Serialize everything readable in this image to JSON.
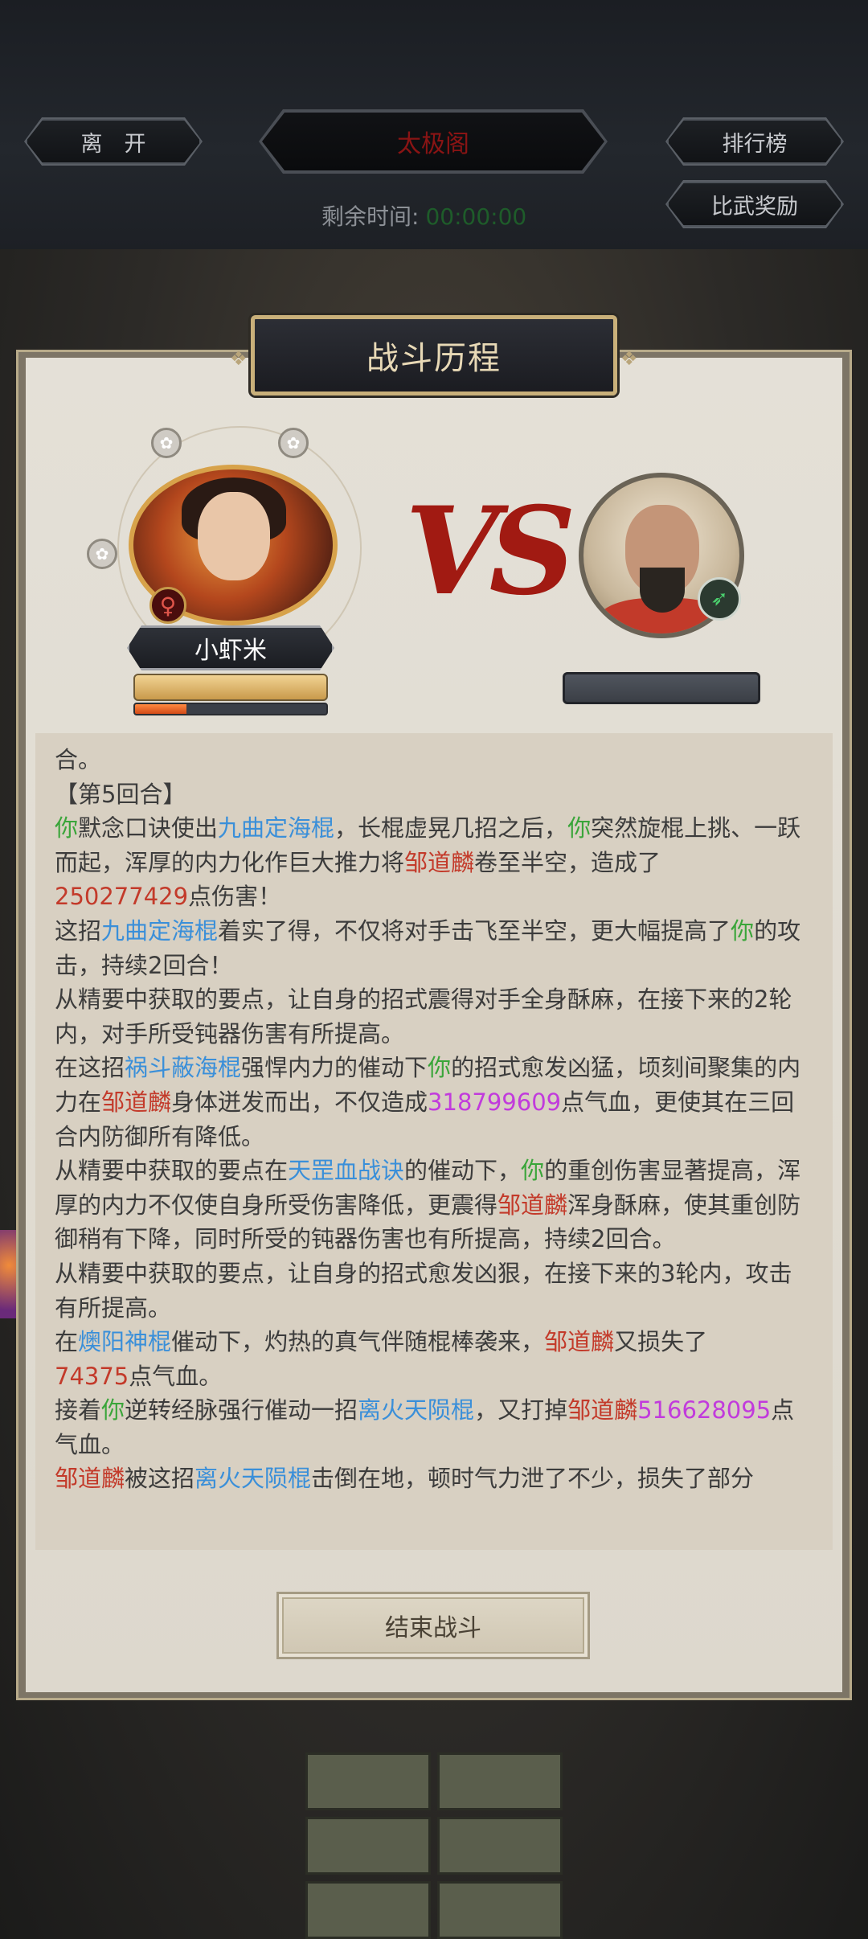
{
  "topbar": {
    "leave_label": "离　开",
    "title": "太极阁",
    "leaderboard_label": "排行榜",
    "reward_label": "比武奖励",
    "timer_label": "剩余时间:",
    "timer_value": "00:00:00"
  },
  "dialog": {
    "title": "战斗历程",
    "player_name": "小虾米",
    "player_gender_icon": "female-symbol-icon",
    "player_progress": 0.27,
    "vs_text": "VS",
    "opponent_rank_icon": "rank-icon",
    "end_button_label": "结束战斗"
  },
  "log": {
    "line0": "合。",
    "round_label": "【第5回合】",
    "s1a": "你",
    "s1b": "默念口诀使出",
    "s1c": "九曲定海棍",
    "s1d": "，长棍虚晃几招之后，",
    "s1e": "你",
    "s1f": "突然旋棍上挑、一跃而起，浑厚的内力化作巨大推力将",
    "s1g": "邹道麟",
    "s1h": "卷至半空，造成了",
    "s1i": "250277429",
    "s1j": "点伤害！",
    "s2a": "这招",
    "s2b": "九曲定海棍",
    "s2c": "着实了得，不仅将对手击飞至半空，更大幅提高了",
    "s2d": "你",
    "s2e": "的攻击，持续2回合！",
    "s3": "从精要中获取的要点，让自身的招式震得对手全身酥麻，在接下来的2轮内，对手所受钝器伤害有所提高。",
    "s4a": "在这招",
    "s4b": "祸斗蔽海棍",
    "s4c": "强悍内力的催动下",
    "s4d": "你",
    "s4e": "的招式愈发凶猛，顷刻间聚集的内力在",
    "s4f": "邹道麟",
    "s4g": "身体迸发而出，不仅造成",
    "s4h": "318799609",
    "s4i": "点气血，更使其在三回合内防御所有降低。",
    "s5a": "从精要中获取的要点在",
    "s5b": "天罡血战诀",
    "s5c": "的催动下，",
    "s5d": "你",
    "s5e": "的重创伤害显著提高，浑厚的内力不仅使自身所受伤害降低，更震得",
    "s5f": "邹道麟",
    "s5g": "浑身酥麻，使其重创防御稍有下降，同时所受的钝器伤害也有所提高，持续2回合。",
    "s6": "从精要中获取的要点，让自身的招式愈发凶狠，在接下来的3轮内，攻击有所提高。",
    "s7a": "在",
    "s7b": "燠阳神棍",
    "s7c": "催动下，灼热的真气伴随棍棒袭来，",
    "s7d": "邹道麟",
    "s7e": "又损失了",
    "s7f": "74375",
    "s7g": "点气血。",
    "s8a": "接着",
    "s8b": "你",
    "s8c": "逆转经脉强行催动一招",
    "s8d": "离火天陨棍",
    "s8e": "，又打掉",
    "s8f": "邹道麟",
    "s8g": "516628095",
    "s8h": "点气血。",
    "s9a": "邹道麟",
    "s9b": "被这招",
    "s9c": "离火天陨棍",
    "s9d": "击倒在地，顿时气力泄了不少，损失了部分"
  },
  "colors": {
    "self": "#3aa53a",
    "skill": "#3a8fd9",
    "enemy": "#c33a2a",
    "damage_alt": "#c13bdc"
  }
}
